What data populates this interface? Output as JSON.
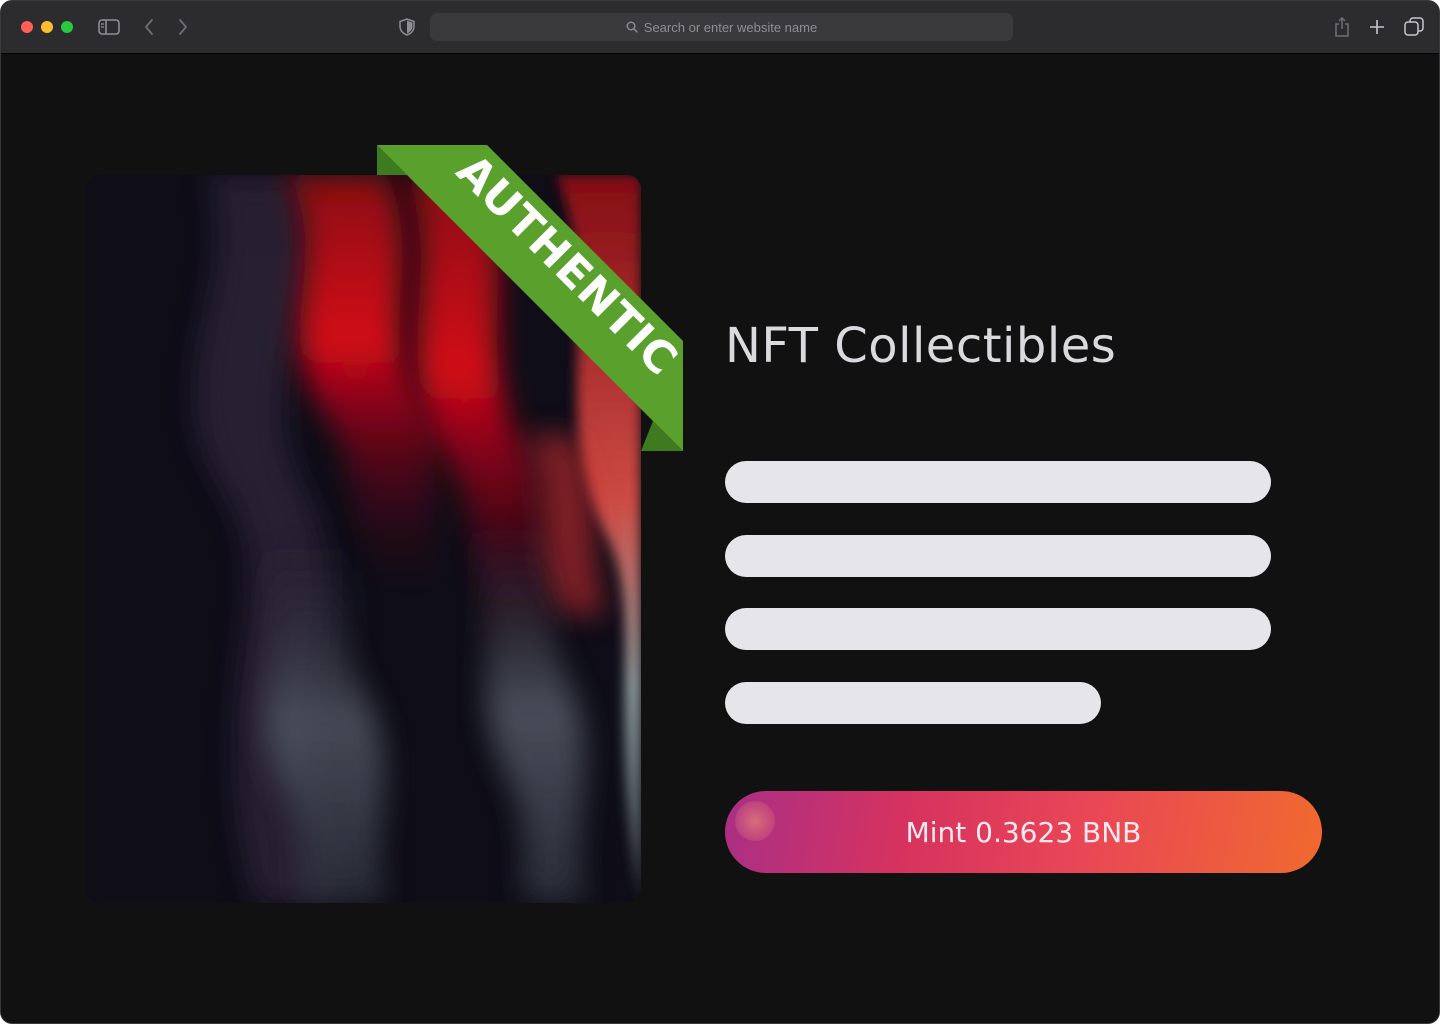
{
  "browser": {
    "address_placeholder": "Search or enter website name",
    "icons": [
      "sidebar-icon",
      "back-icon",
      "forward-icon",
      "privacy-shield-icon",
      "search-icon",
      "share-icon",
      "new-tab-icon",
      "tab-overview-icon"
    ]
  },
  "page": {
    "badge": "AUTHENTIC",
    "title": "NFT Collectibles",
    "text_placeholder_lines": 4,
    "mint_label": "Mint 0.3623 BNB"
  },
  "colors": {
    "page_bg": "#111111",
    "ribbon": "#5aa02c",
    "ribbon_fold": "#3e7a20",
    "placeholder": "#e5e5ea",
    "mint_gradient_start": "#a92f86",
    "mint_gradient_end": "#f06a2e"
  }
}
